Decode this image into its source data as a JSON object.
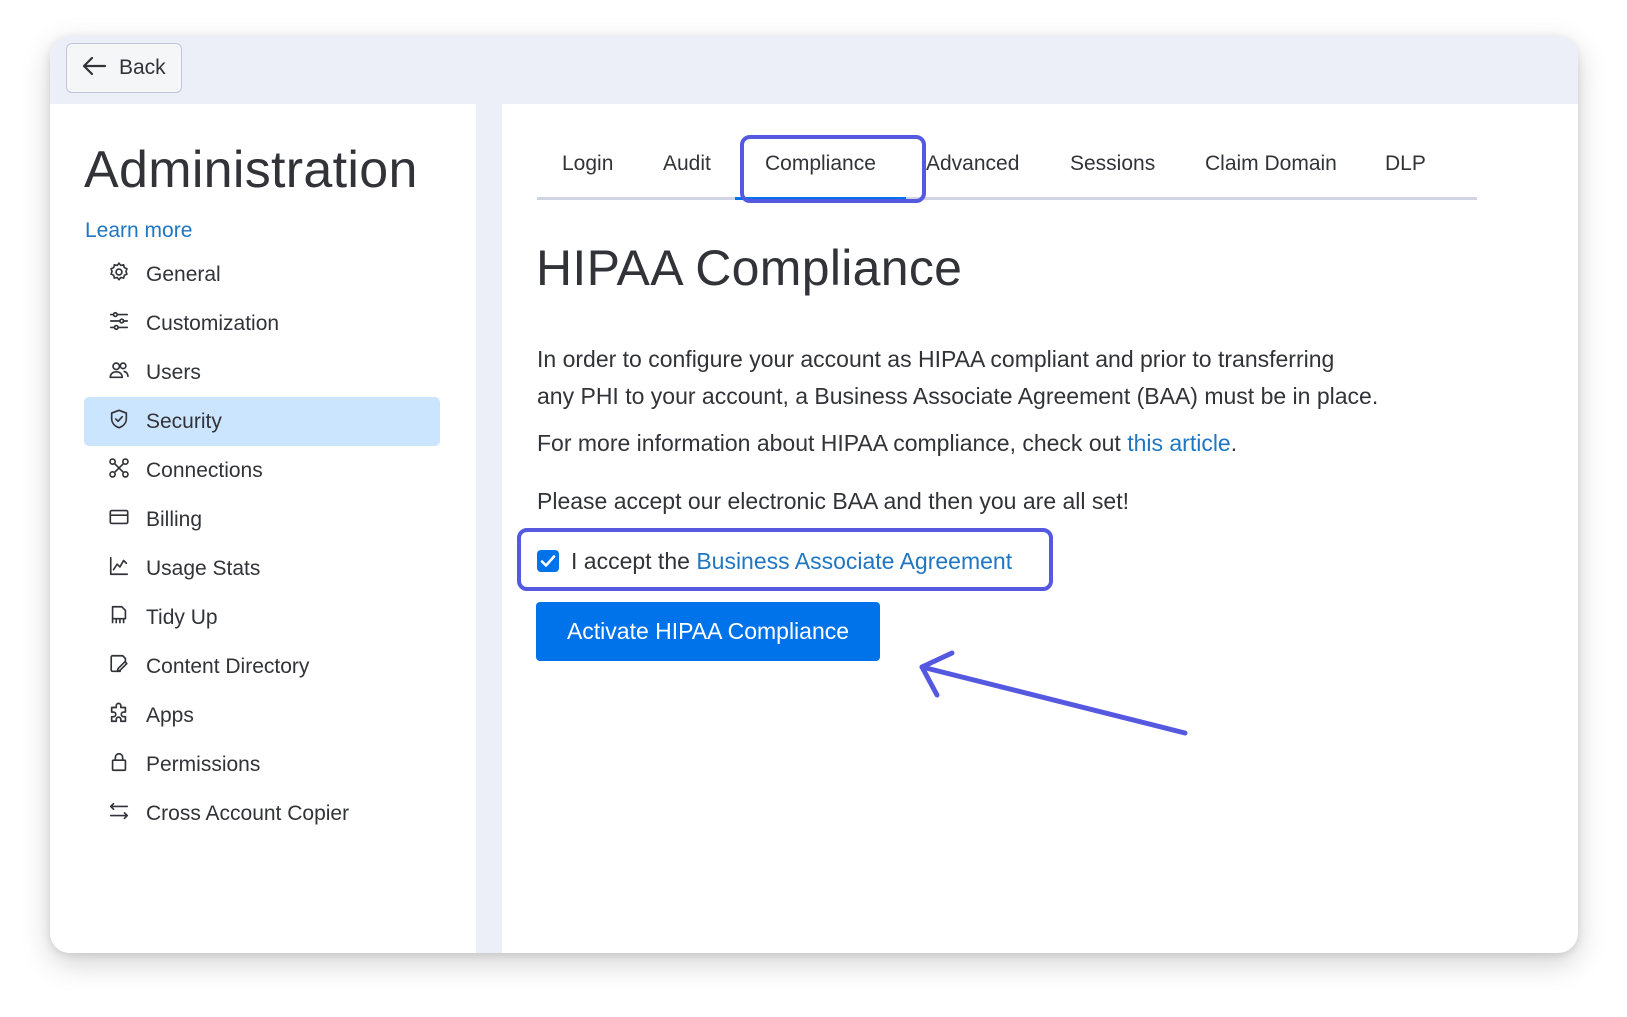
{
  "header": {
    "back_label": "Back"
  },
  "sidebar": {
    "title": "Administration",
    "learn_more": "Learn more",
    "items": [
      {
        "label": "General",
        "icon": "gear-icon"
      },
      {
        "label": "Customization",
        "icon": "sliders-icon"
      },
      {
        "label": "Users",
        "icon": "users-icon"
      },
      {
        "label": "Security",
        "icon": "shield-icon",
        "active": true
      },
      {
        "label": "Connections",
        "icon": "connections-icon"
      },
      {
        "label": "Billing",
        "icon": "credit-card-icon"
      },
      {
        "label": "Usage Stats",
        "icon": "chart-icon"
      },
      {
        "label": "Tidy Up",
        "icon": "broom-icon"
      },
      {
        "label": "Content Directory",
        "icon": "edit-document-icon"
      },
      {
        "label": "Apps",
        "icon": "puzzle-icon"
      },
      {
        "label": "Permissions",
        "icon": "lock-icon"
      },
      {
        "label": "Cross Account Copier",
        "icon": "swap-arrows-icon"
      }
    ]
  },
  "tabs": {
    "items": [
      "Login",
      "Audit",
      "Compliance",
      "Advanced",
      "Sessions",
      "Claim Domain",
      "DLP"
    ],
    "active": "Compliance"
  },
  "content": {
    "title": "HIPAA Compliance",
    "paragraph1_line1": "In order to configure your account as HIPAA compliant and prior to transferring",
    "paragraph1_line2": "any PHI to your account, a Business Associate Agreement (BAA) must be in place.",
    "paragraph2_prefix": "For more information about HIPAA compliance, check out ",
    "paragraph2_link": "this article",
    "paragraph2_suffix": ".",
    "paragraph3": "Please accept our electronic BAA and then you are all set!",
    "checkbox_prefix": "I accept the ",
    "checkbox_link": "Business Associate Agreement",
    "checkbox_checked": true,
    "activate_button": "Activate HIPAA Compliance"
  },
  "colors": {
    "primary": "#0073ea",
    "link": "#1f76c2",
    "highlight": "#5559df",
    "active_nav_bg": "#cce5ff"
  }
}
